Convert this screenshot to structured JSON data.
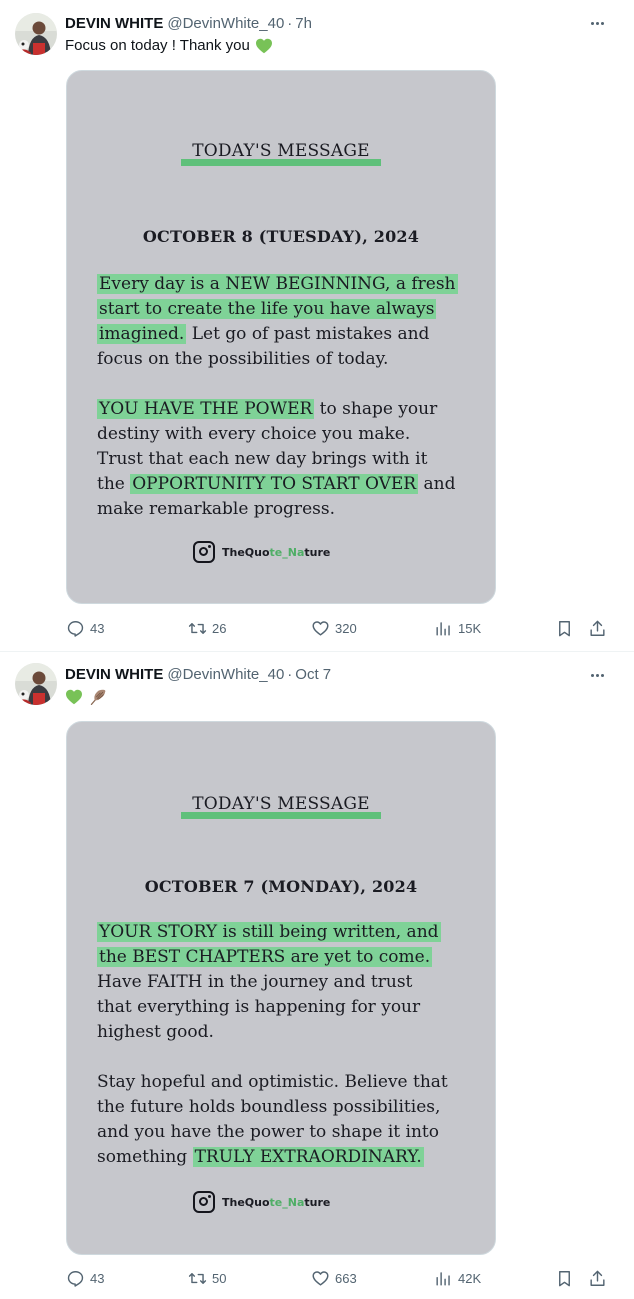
{
  "colors": {
    "heart_green": "#78c257",
    "highlight": "#7fd297",
    "card_bg": "#c6c7cc",
    "secondary_text": "#536471"
  },
  "tweets": [
    {
      "author": {
        "name": "DEVIN WHITE",
        "handle": "@DevinWhite_40"
      },
      "separator": "·",
      "time": "7h",
      "text": "Focus on today ! Thank you",
      "emoji": [
        "green-heart"
      ],
      "card": {
        "heading": "TODAY'S MESSAGE",
        "date": "OCTOBER 8 (TUESDAY), 2024",
        "p1": [
          [
            {
              "t": "Every day is a NEW BEGINNING, a fresh",
              "hl": true
            }
          ],
          [
            {
              "t": "start to create the life you have always",
              "hl": true
            }
          ],
          [
            {
              "t": "imagined.",
              "hl": true
            },
            {
              "t": " Let go of past mistakes and",
              "hl": false
            }
          ],
          [
            {
              "t": "focus on the possibilities of today.",
              "hl": false
            }
          ]
        ],
        "p2": [
          [
            {
              "t": "YOU HAVE THE POWER",
              "hl": true
            },
            {
              "t": " to shape your",
              "hl": false
            }
          ],
          [
            {
              "t": "destiny with every choice you make.",
              "hl": false
            }
          ],
          [
            {
              "t": "Trust that each new day brings with it",
              "hl": false
            }
          ],
          [
            {
              "t": "the ",
              "hl": false
            },
            {
              "t": "OPPORTUNITY TO START OVER",
              "hl": true
            },
            {
              "t": " and",
              "hl": false
            }
          ],
          [
            {
              "t": "make remarkable progress.",
              "hl": false
            }
          ]
        ],
        "brand": {
          "a": "TheQuo",
          "b": "te_Na",
          "c": "ture"
        }
      },
      "actions": {
        "replies": "43",
        "reposts": "26",
        "likes": "320",
        "views": "15K"
      }
    },
    {
      "author": {
        "name": "DEVIN WHITE",
        "handle": "@DevinWhite_40"
      },
      "separator": "·",
      "time": "Oct 7",
      "text": "",
      "emoji": [
        "green-heart",
        "feather"
      ],
      "card": {
        "heading": "TODAY'S MESSAGE",
        "date": "OCTOBER 7 (MONDAY), 2024",
        "p1": [
          [
            {
              "t": "YOUR STORY is still being written, and",
              "hl": true
            }
          ],
          [
            {
              "t": "the BEST CHAPTERS are yet to come.",
              "hl": true
            }
          ],
          [
            {
              "t": "Have FAITH in the journey and trust",
              "hl": false
            }
          ],
          [
            {
              "t": "that everything is happening for your",
              "hl": false
            }
          ],
          [
            {
              "t": "highest good.",
              "hl": false
            }
          ]
        ],
        "p2": [
          [
            {
              "t": "Stay hopeful and optimistic. Believe that",
              "hl": false
            }
          ],
          [
            {
              "t": "the future holds boundless possibilities,",
              "hl": false
            }
          ],
          [
            {
              "t": "and you have the power to shape it into",
              "hl": false
            }
          ],
          [
            {
              "t": "something ",
              "hl": false
            },
            {
              "t": "TRULY EXTRAORDINARY.",
              "hl": true
            }
          ]
        ],
        "brand": {
          "a": "TheQuo",
          "b": "te_Na",
          "c": "ture"
        }
      },
      "actions": {
        "replies": "43",
        "reposts": "50",
        "likes": "663",
        "views": "42K"
      }
    }
  ]
}
